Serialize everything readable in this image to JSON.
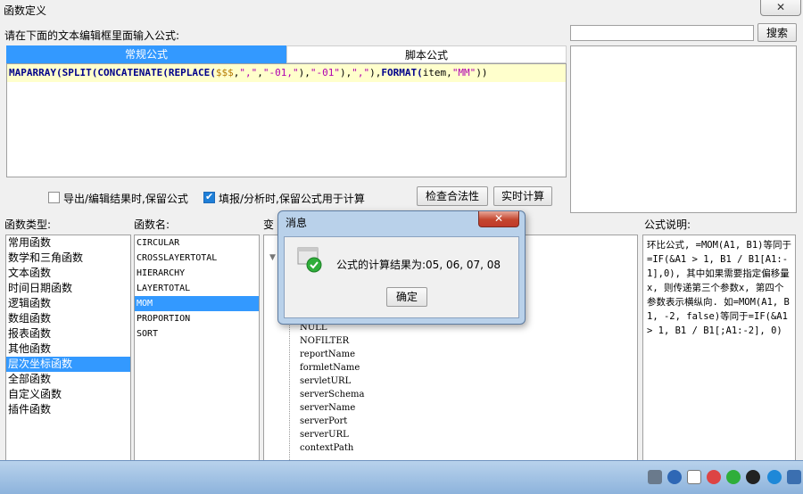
{
  "window": {
    "title": "函数定义",
    "close_label": "✕"
  },
  "editor": {
    "label": "请在下面的文本编辑框里面输入公式:",
    "tabs": {
      "normal": "常规公式",
      "script": "脚本公式"
    },
    "formula_tokens": [
      {
        "t": "MAPARRAY(",
        "c": "fn"
      },
      {
        "t": "SPLIT(",
        "c": "fn"
      },
      {
        "t": "CONCATENATE(",
        "c": "fn"
      },
      {
        "t": "REPLACE(",
        "c": "fn"
      },
      {
        "t": "$$$",
        "c": "plc"
      },
      {
        "t": ",",
        "c": "pl"
      },
      {
        "t": "\",\"",
        "c": "str"
      },
      {
        "t": ",",
        "c": "pl"
      },
      {
        "t": "\"-01,\"",
        "c": "str"
      },
      {
        "t": "),",
        "c": "pl"
      },
      {
        "t": "\"-01\"",
        "c": "str"
      },
      {
        "t": "),",
        "c": "pl"
      },
      {
        "t": "\",\"",
        "c": "str"
      },
      {
        "t": "),",
        "c": "pl"
      },
      {
        "t": "FORMAT(",
        "c": "fn"
      },
      {
        "t": "item,",
        "c": "pl"
      },
      {
        "t": "\"MM\"",
        "c": "str"
      },
      {
        "t": "))",
        "c": "pl"
      }
    ]
  },
  "options": {
    "keep_formula_export": "导出/编辑结果时,保留公式",
    "keep_formula_fill": "填报/分析时,保留公式用于计算",
    "check_button": "检查合法性",
    "realtime_button": "实时计算"
  },
  "search": {
    "button": "搜索"
  },
  "columns": {
    "type_label": "函数类型:",
    "name_label": "函数名:",
    "var_label": "变",
    "desc_label": "公式说明:"
  },
  "function_types": [
    "常用函数",
    "数学和三角函数",
    "文本函数",
    "时间日期函数",
    "逻辑函数",
    "数组函数",
    "报表函数",
    "其他函数",
    "层次坐标函数",
    "全部函数",
    "自定义函数",
    "插件函数"
  ],
  "function_types_selected": 8,
  "function_names": [
    "CIRCULAR",
    "CROSSLAYERTOTAL",
    "HIERARCHY",
    "LAYERTOTAL",
    "MOM",
    "PROPORTION",
    "SORT"
  ],
  "function_names_selected": 4,
  "variables": [
    "NULL",
    "NOFILTER",
    "reportName",
    "formletName",
    "servletURL",
    "serverSchema",
    "serverName",
    "serverPort",
    "serverURL",
    "contextPath"
  ],
  "description": "环比公式, =MOM(A1, B1)等同于=IF(&A1 > 1, B1 / B1[A1:-1],0), 其中如果需要指定偏移量x, 则传递第三个参数x, 第四个参数表示横纵向. 如=MOM(A1, B1, -2, false)等同于=IF(&A1 > 1, B1 / B1[;A1:-2], 0)",
  "dialog": {
    "title": "消息",
    "message": "公式的计算结果为:05, 06, 07, 08",
    "ok": "确定",
    "close": "✕"
  }
}
